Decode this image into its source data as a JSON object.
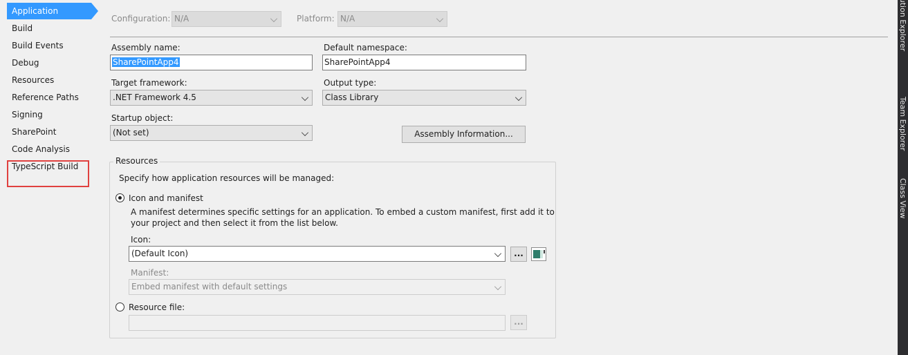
{
  "nav": {
    "items": [
      {
        "label": "Application",
        "active": true
      },
      {
        "label": "Build"
      },
      {
        "label": "Build Events"
      },
      {
        "label": "Debug"
      },
      {
        "label": "Resources"
      },
      {
        "label": "Reference Paths"
      },
      {
        "label": "Signing"
      },
      {
        "label": "SharePoint"
      },
      {
        "label": "Code Analysis"
      },
      {
        "label": "TypeScript Build"
      }
    ]
  },
  "header": {
    "configuration_label": "Configuration:",
    "configuration_value": "N/A",
    "platform_label": "Platform:",
    "platform_value": "N/A"
  },
  "form": {
    "assembly_name_label": "Assembly name:",
    "assembly_name_value": "SharePointApp4",
    "default_namespace_label": "Default namespace:",
    "default_namespace_value": "SharePointApp4",
    "target_framework_label": "Target framework:",
    "target_framework_value": ".NET Framework 4.5",
    "output_type_label": "Output type:",
    "output_type_value": "Class Library",
    "startup_object_label": "Startup object:",
    "startup_object_value": "(Not set)",
    "assembly_info_button": "Assembly Information..."
  },
  "resources": {
    "group_title": "Resources",
    "description": "Specify how application resources will be managed:",
    "icon_manifest_label": "Icon and manifest",
    "icon_manifest_desc_line1": "A manifest determines specific settings for an application. To embed a custom manifest, first add it to",
    "icon_manifest_desc_line2": "your project and then select it from the list below.",
    "icon_label": "Icon:",
    "icon_value": "(Default Icon)",
    "browse_button": "...",
    "manifest_label": "Manifest:",
    "manifest_value": "Embed manifest with default settings",
    "resource_file_label": "Resource file:",
    "resource_file_value": "",
    "resource_browse_button": "..."
  },
  "side_tabs": [
    "Solution Explorer",
    "Team Explorer",
    "Class View"
  ],
  "colors": {
    "accent": "#3399ff",
    "highlight_box": "#e0413f",
    "side_strip": "#2d2d30"
  }
}
